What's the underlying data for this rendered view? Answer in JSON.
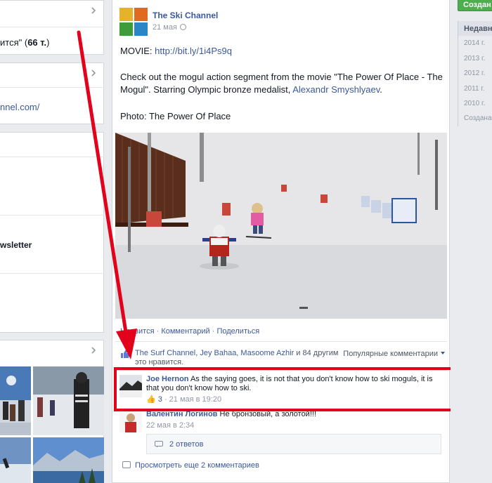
{
  "left": {
    "box1_text": "ится\"",
    "box1_count": "66 т.",
    "box2_link": "nnel.com/",
    "box3_text": "wsletter"
  },
  "post": {
    "page_name": "The Ski Channel",
    "date": "21 мая",
    "movie_label": "MOVIE: ",
    "movie_link": "http://bit.ly/1i4Ps9q",
    "body_text": "Check out the mogul action segment from the movie \"The Power Of Place - The Mogul\". Starring Olympic bronze medalist, ",
    "athlete_link": "Alexandr Smyshlyaev",
    "body_end": ".",
    "photo_credit": "Photo: The Power Of Place",
    "actions": {
      "like": "Нравится",
      "comment": "Комментарий",
      "share": "Поделиться",
      "dot": "·"
    },
    "likes": {
      "names": "The Surf Channel, Jey Bahaa, Masoome Azhir",
      "rest": " и 84 другим это нравится.",
      "popular": "Популярные комментарии"
    },
    "comments": [
      {
        "author": "Joe Hernon",
        "text": " As the saying goes, it is not that you don't know how to ski moguls, it is that you don't know how to ski.",
        "likes": "3",
        "time": "21 мая в 19:20"
      },
      {
        "author": "Валентин Логинов",
        "text": " Не бронзовый, а золотой!!!",
        "time": "22 мая в 2:34"
      }
    ],
    "replies": "2 ответов",
    "more_comments": "Просмотреть еще 2 комментариев"
  },
  "right": {
    "create_button": "Создан",
    "years": [
      "Недавн",
      "2014 г.",
      "2013 г.",
      "2012 г.",
      "2011 г.",
      "2010 г.",
      "Создана"
    ]
  },
  "colors": {
    "highlight": "#e3021b",
    "brand_link": "#3b5998",
    "create_green": "#4cae4c"
  }
}
